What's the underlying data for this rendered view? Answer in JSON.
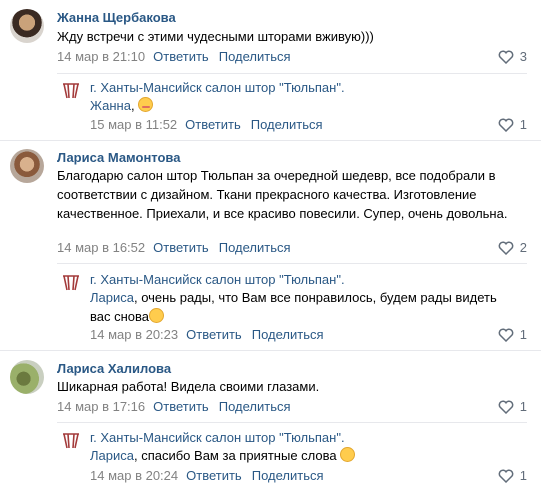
{
  "colors": {
    "link": "#2a5885",
    "meta": "#828282",
    "like": "#626d7a",
    "logo": "#a33a3a"
  },
  "comments": [
    {
      "author": "Жанна Щербакова",
      "text": "Жду встречи с этими чудесными шторами вживую)))",
      "date": "14 мар в 21:10",
      "reply_label": "Ответить",
      "share_label": "Поделиться",
      "likes": "3",
      "reply": {
        "author": "г. Ханты-Мансийск салон штор \"Тюльпан\".",
        "addressee": "Жанна",
        "text": ", ",
        "emoji": "smiling-face-with-hearts",
        "date": "15 мар в 11:52",
        "reply_label": "Ответить",
        "share_label": "Поделиться",
        "likes": "1"
      }
    },
    {
      "author": "Лариса Мамонтова",
      "text": "Благодарю салон штор Тюльпан за очередной шедевр, все подобрали в соответствии с дизайном. Ткани прекрасного качества. Изготовление качественное. Приехали, и все красиво повесили. Супер, очень довольна.",
      "date": "14 мар в 16:52",
      "reply_label": "Ответить",
      "share_label": "Поделиться",
      "likes": "2",
      "reply": {
        "author": "г. Ханты-Мансийск салон штор \"Тюльпан\".",
        "addressee": "Лариса",
        "text": ", очень рады, что Вам все понравилось, будем рады видеть вас снова",
        "emoji": "flushed-face",
        "date": "14 мар в 20:23",
        "reply_label": "Ответить",
        "share_label": "Поделиться",
        "likes": "1"
      }
    },
    {
      "author": "Лариса Халилова",
      "text": "Шикарная работа! Видела своими глазами.",
      "date": "14 мар в 17:16",
      "reply_label": "Ответить",
      "share_label": "Поделиться",
      "likes": "1",
      "reply": {
        "author": "г. Ханты-Мансийск салон штор \"Тюльпан\".",
        "addressee": "Лариса",
        "text": ", спасибо Вам за приятные слова ",
        "emoji": "flushed-face",
        "date": "14 мар в 20:24",
        "reply_label": "Ответить",
        "share_label": "Поделиться",
        "likes": "1"
      }
    }
  ]
}
